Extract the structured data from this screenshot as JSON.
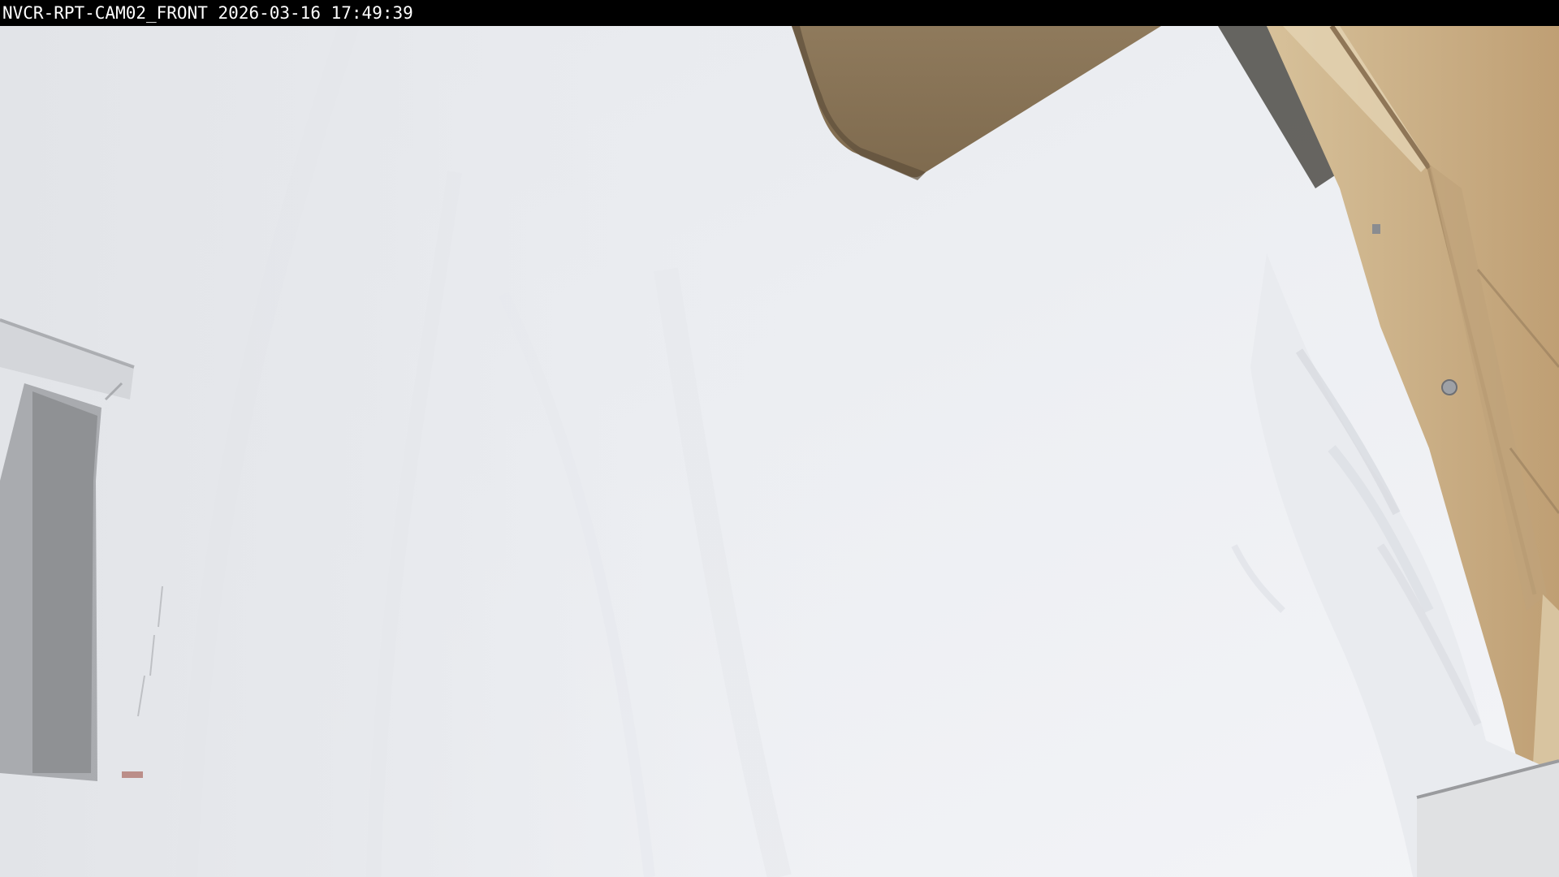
{
  "overlay": {
    "camera_id": "NVCR-RPT-CAM02_FRONT",
    "date": "2026-03-16",
    "time": "17:49:39"
  },
  "colors": {
    "overlay_background": "#000000",
    "overlay_text": "#ffffff",
    "snow": "#eef0f4",
    "fog": "#e4e6ea",
    "roof_eave": "#8a7456",
    "wood_siding": "#cdb48d",
    "distant_building": "#6e7074"
  },
  "scene": {
    "description_elements": [
      "snow-field",
      "roof-eave",
      "building-wall",
      "distant-building",
      "snow-drift",
      "marker-post"
    ]
  }
}
